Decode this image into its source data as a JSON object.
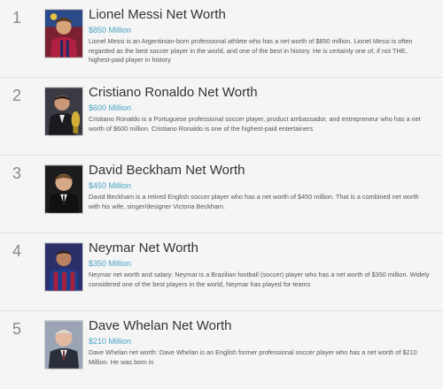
{
  "items": [
    {
      "rank": "1",
      "title": "Lionel Messi Net Worth",
      "worth": "$850 Million",
      "description": "Lionel Messi is an Argentinian-born professional athlete who has a net worth of $850 million. Lionel Messi is often regarded as the best soccer player in the world, and one of the best in history. He is certainly one of, if not THE, highest-paid player in history",
      "image_icon": "person-photo-icon"
    },
    {
      "rank": "2",
      "title": "Cristiano Ronaldo Net Worth",
      "worth": "$600 Million",
      "description": "Cristiano Ronaldo is a Portuguese professional soccer player, product ambassador, and entrepreneur who has a net worth of $600 million. Cristiano Ronaldo is one of the highest-paid entertainers",
      "image_icon": "person-photo-icon"
    },
    {
      "rank": "3",
      "title": "David Beckham Net Worth",
      "worth": "$450 Million",
      "description": "David Beckham is a retired English soccer player who has a net worth of $450 million. That is a combined net worth with his wife, singer/designer Victoria Beckham.",
      "image_icon": "person-photo-icon"
    },
    {
      "rank": "4",
      "title": "Neymar Net Worth",
      "worth": "$350 Million",
      "description": "Neymar net worth and salary: Neymar is a Brazilian football (soccer) player who has a net worth of $350 million. Widely considered one of the best players in the world, Neymar has played for teams",
      "image_icon": "person-photo-icon"
    },
    {
      "rank": "5",
      "title": "Dave Whelan Net Worth",
      "worth": "$210 Million",
      "description": "Dave Whelan net worth: Dave Whelan is an English former professional soccer player who has a net worth of $210 Million. He was born in",
      "image_icon": "person-photo-icon"
    }
  ],
  "colors": {
    "worth_link": "#4aa3c4",
    "title": "#333333",
    "rank": "#888888",
    "background": "#f5f5f5",
    "divider": "#e1e1e1"
  }
}
